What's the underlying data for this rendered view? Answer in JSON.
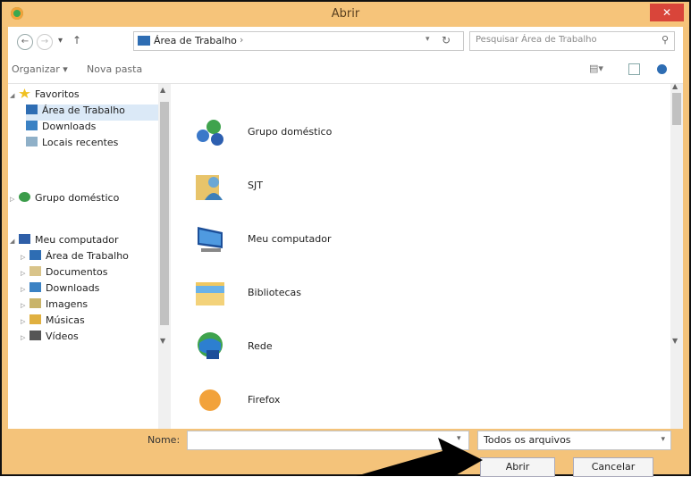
{
  "window": {
    "title": "Abrir",
    "close_label": "✕"
  },
  "address": {
    "breadcrumb": "Área de Trabalho",
    "separator": "›",
    "search_placeholder": "Pesquisar Área de Trabalho"
  },
  "toolbar": {
    "organize_label": "Organizar ▾",
    "new_folder_label": "Nova pasta"
  },
  "sidebar": {
    "favorites": "Favoritos",
    "fav_items": [
      "Área de Trabalho",
      "Downloads",
      "Locais recentes"
    ],
    "homegroup": "Grupo doméstico",
    "computer": "Meu computador",
    "computer_items": [
      "Área de Trabalho",
      "Documentos",
      "Downloads",
      "Imagens",
      "Músicas",
      "Vídeos"
    ]
  },
  "files": [
    "Grupo doméstico",
    "SJT",
    "Meu computador",
    "Bibliotecas",
    "Rede",
    "Firefox"
  ],
  "footer": {
    "name_label": "Nome:",
    "name_value": "",
    "filter_label": "Todos os arquivos",
    "open_label": "Abrir",
    "cancel_label": "Cancelar"
  }
}
